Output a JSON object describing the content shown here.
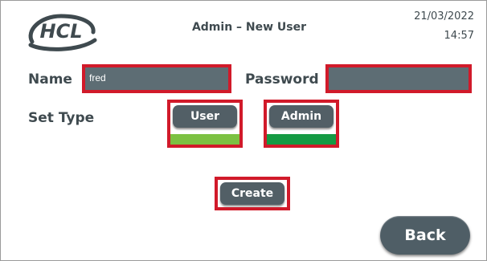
{
  "header": {
    "title": "Admin – New User",
    "date": "21/03/2022",
    "time": "14:57",
    "logo_text": "HCL"
  },
  "form": {
    "name_label": "Name",
    "name_value": "fred",
    "password_label": "Password",
    "password_value": "",
    "set_type_label": "Set Type",
    "user_button_label": "User",
    "admin_button_label": "Admin",
    "create_button_label": "Create"
  },
  "footer": {
    "back_button_label": "Back"
  },
  "colors": {
    "highlight_border": "#d11a2a",
    "user_type_indicator": "#7cc142",
    "admin_type_indicator": "#149a43",
    "button": "#525f66",
    "field": "#5d6d74"
  }
}
